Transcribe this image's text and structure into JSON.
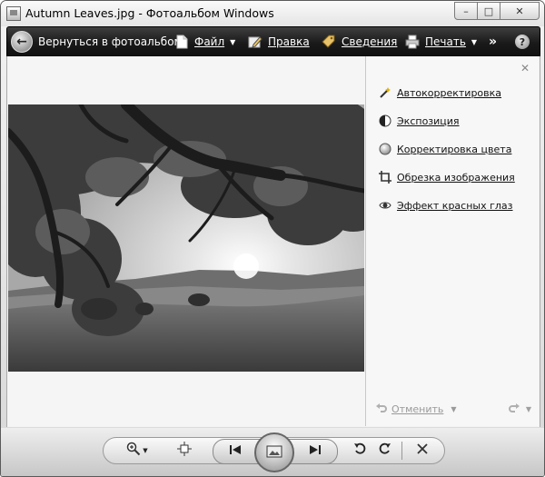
{
  "window": {
    "title": "Autumn Leaves.jpg - Фотоальбом Windows",
    "controls": {
      "minimize": "–",
      "maximize": "□",
      "close": "✕"
    }
  },
  "toolbar": {
    "back_label": "Вернуться в фотоальбом",
    "file_label": "Файл",
    "edit_label": "Правка",
    "info_label": "Сведения",
    "print_label": "Печать",
    "more": "»",
    "help": "?"
  },
  "panel": {
    "close": "✕",
    "items": [
      {
        "label": "Автокорректировка",
        "icon": "magic-wand-icon"
      },
      {
        "label": "Экспозиция",
        "icon": "exposure-icon"
      },
      {
        "label": "Корректировка цвета",
        "icon": "color-balance-icon"
      },
      {
        "label": "Обрезка изображения",
        "icon": "crop-icon"
      },
      {
        "label": "Эффект красных глаз",
        "icon": "red-eye-icon"
      }
    ],
    "undo_label": "Отменить"
  },
  "photo": {
    "name": "Autumn Leaves.jpg",
    "description": "tree-over-meadow-photo"
  },
  "colors": {
    "toolbar_dark": "#1a1a1a",
    "panel_bg": "#f7f7f7",
    "photo_bg": "#f5f5f5"
  }
}
